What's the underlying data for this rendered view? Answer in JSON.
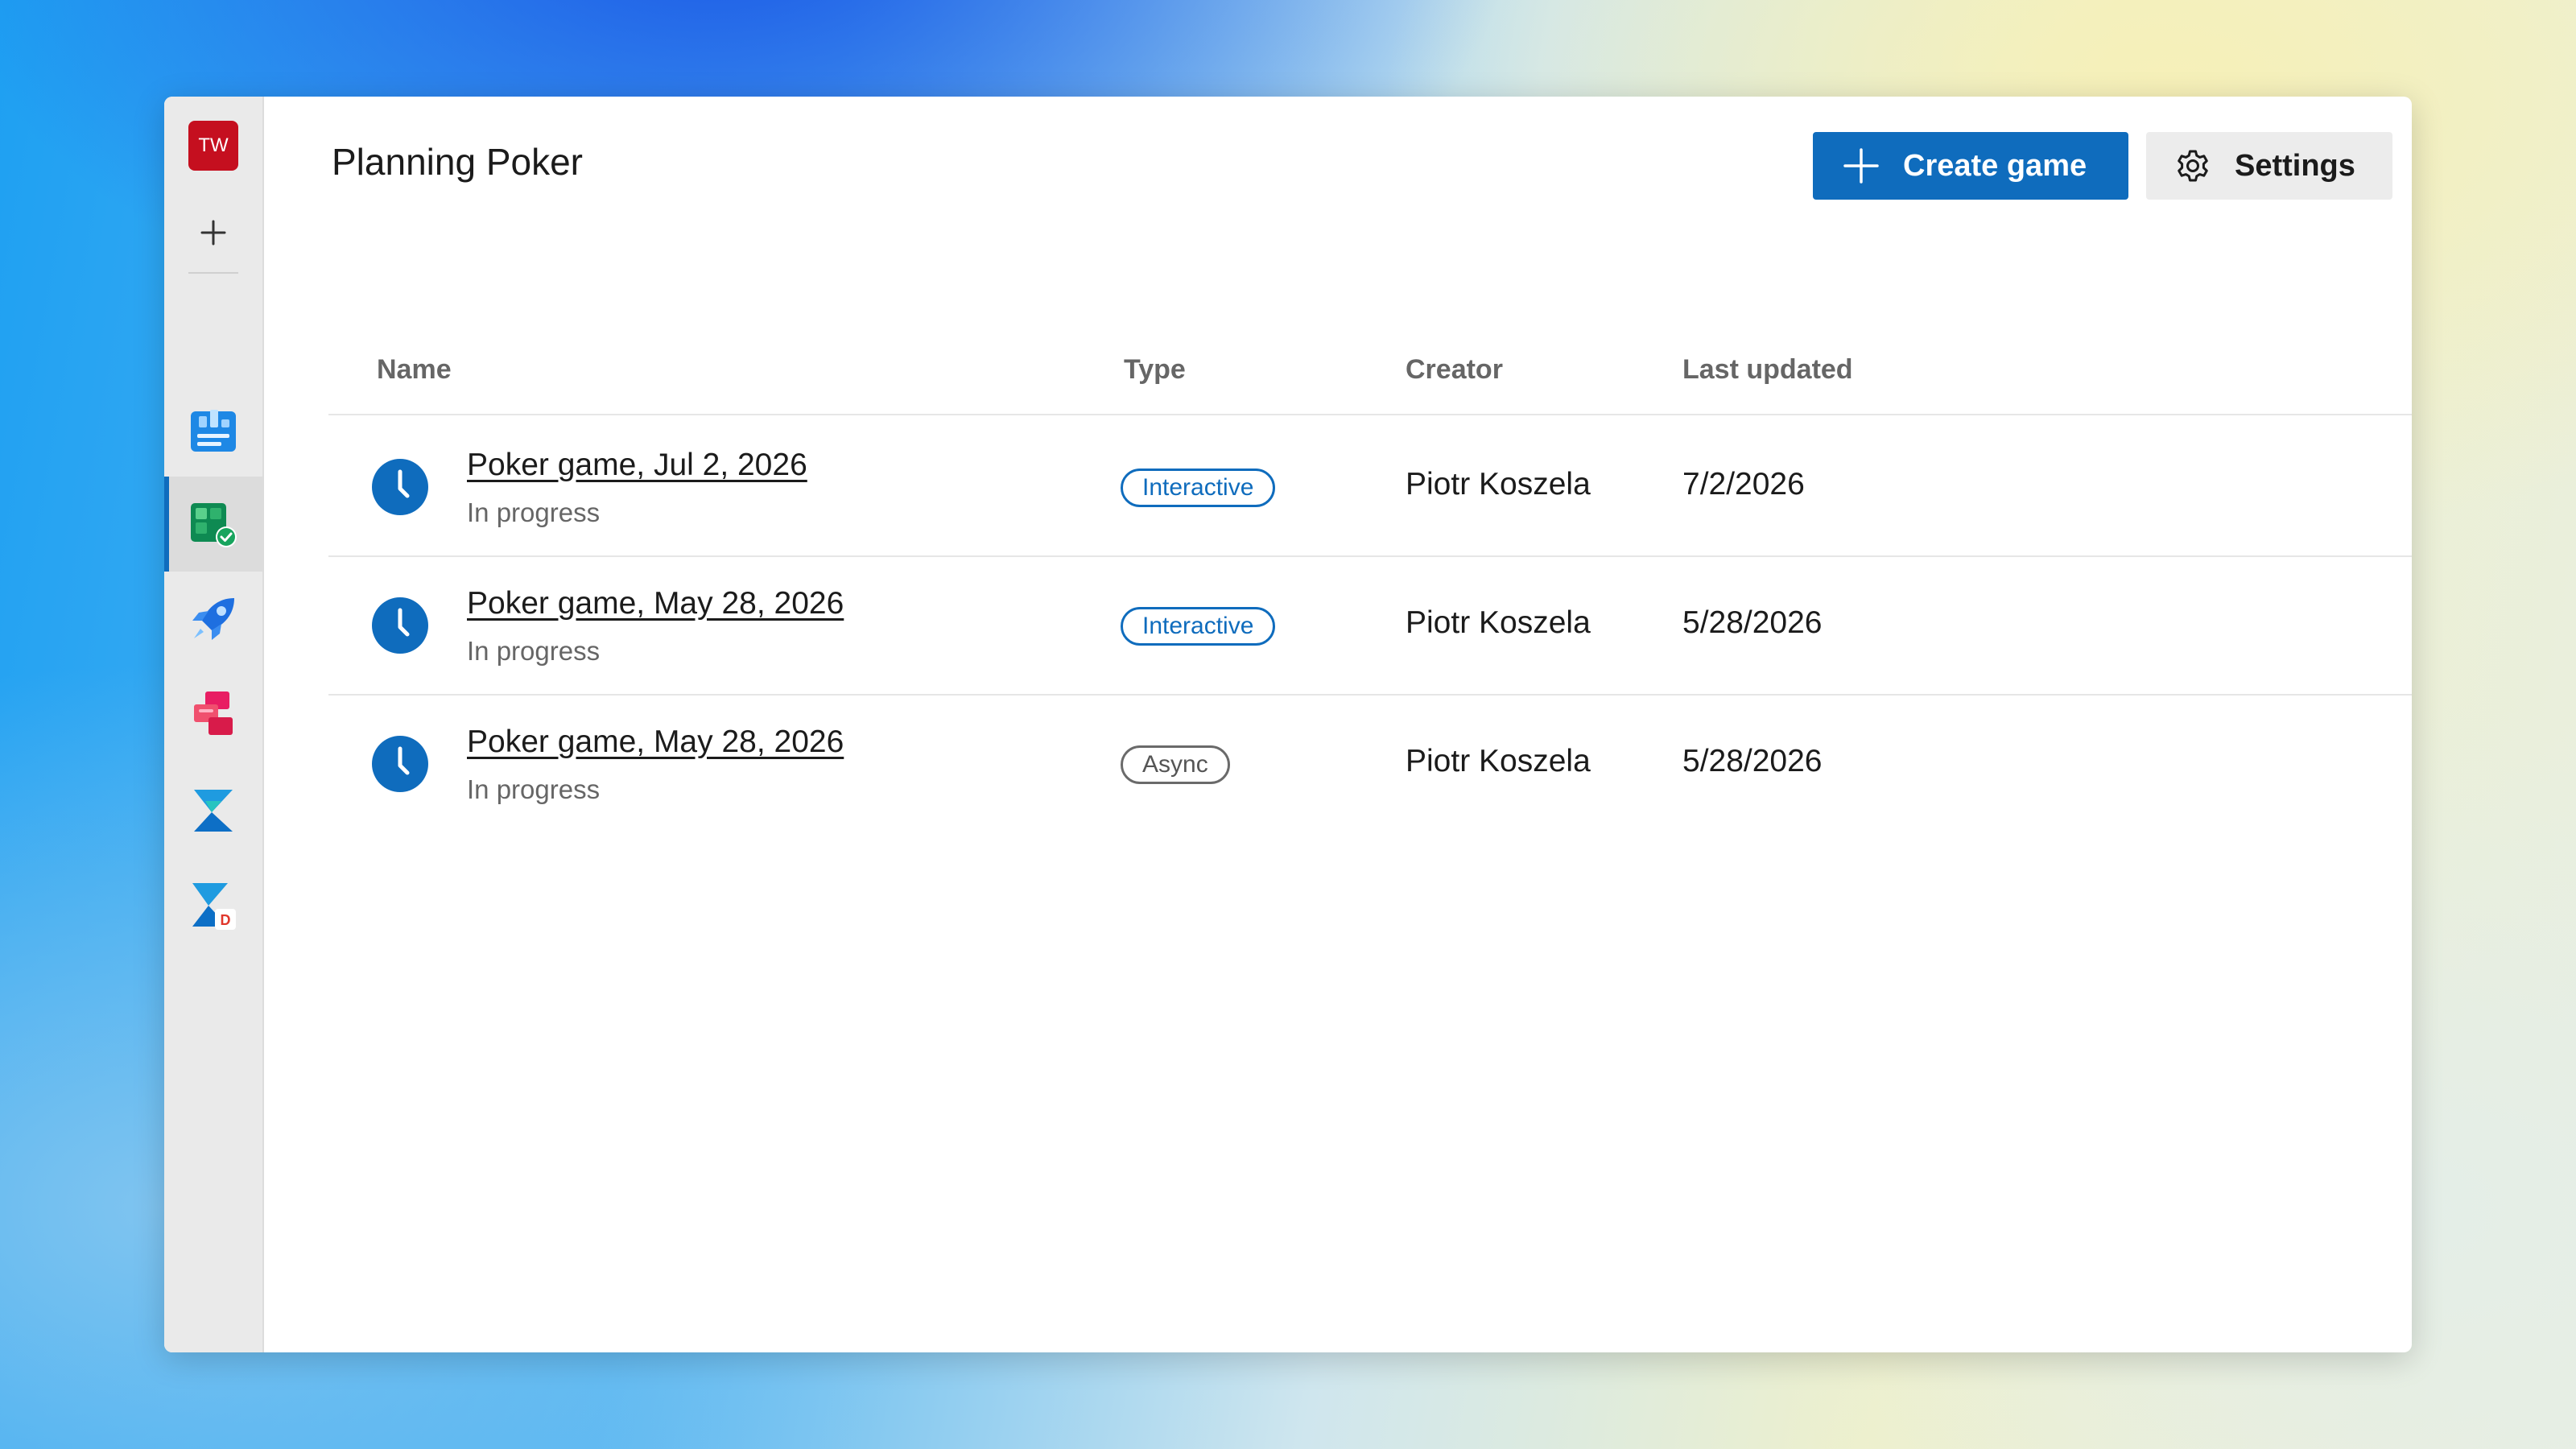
{
  "app": {
    "title": "Planning Poker"
  },
  "rail": {
    "avatar_initials": "TW",
    "items": [
      {
        "name": "boards",
        "icon": "boards-icon",
        "active": false
      },
      {
        "name": "test-plans",
        "icon": "test-plans-icon",
        "active": true
      },
      {
        "name": "pipelines",
        "icon": "pipelines-icon",
        "active": false
      },
      {
        "name": "artifacts",
        "icon": "artifacts-icon",
        "active": false
      },
      {
        "name": "extension-z",
        "icon": "z-logo-icon",
        "active": false
      },
      {
        "name": "extension-zd",
        "icon": "z-logo-d-icon",
        "active": false
      }
    ]
  },
  "toolbar": {
    "create_label": "Create game",
    "settings_label": "Settings"
  },
  "table": {
    "columns": [
      "Name",
      "Type",
      "Creator",
      "Last updated"
    ],
    "rows": [
      {
        "name": "Poker game, Jul 2, 2026",
        "status": "In progress",
        "type": "Interactive",
        "creator": "Piotr Koszela",
        "updated": "7/2/2026"
      },
      {
        "name": "Poker game, May 28, 2026",
        "status": "In progress",
        "type": "Interactive",
        "creator": "Piotr Koszela",
        "updated": "5/28/2026"
      },
      {
        "name": "Poker game, May 28, 2026",
        "status": "In progress",
        "type": "Async",
        "creator": "Piotr Koszela",
        "updated": "5/28/2026"
      }
    ]
  },
  "colors": {
    "accent": "#0f6cbd",
    "avatar": "#c50f1f",
    "async_badge": "#6a6a6a"
  }
}
